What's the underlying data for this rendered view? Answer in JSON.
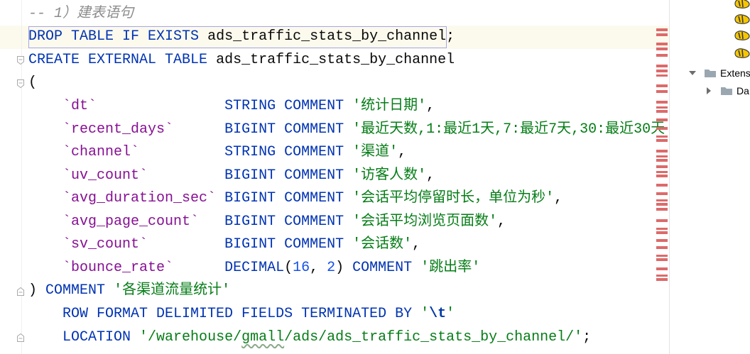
{
  "syntax_colors": {
    "keyword": "#0033b3",
    "identifier": "#080808",
    "quoted_identifier": "#871094",
    "string": "#067d17",
    "number": "#1750eb",
    "comment": "#8c8c8c",
    "escape": "#0037a6",
    "plain": "#080808"
  },
  "editor_colors": {
    "current_line": "#fcfaed",
    "statement_box": "#a7a7e8",
    "error_stripe_mark": "#dd6a6a",
    "typo_underline": "#8aa88a"
  },
  "editor": {
    "lines": [
      {
        "tokens": [
          {
            "comment": "-- 1）建表语句"
          }
        ]
      },
      {
        "current": true,
        "tokens": [
          {
            "keyword": "DROP TABLE IF EXISTS"
          },
          {
            "plain": " "
          },
          {
            "identifier": "ads_traffic_stats_by_channel"
          },
          {
            "plain": ";"
          }
        ]
      },
      {
        "fold_start": true,
        "tokens": [
          {
            "keyword": "CREATE EXTERNAL TABLE"
          },
          {
            "plain": " "
          },
          {
            "identifier": "ads_traffic_stats_by_channel"
          }
        ]
      },
      {
        "fold_start": true,
        "tokens": [
          {
            "plain": "("
          }
        ]
      },
      {
        "tokens": [
          {
            "plain": "    "
          },
          {
            "quoted_identifier": "`dt`"
          },
          {
            "plain": "               "
          },
          {
            "keyword": "STRING COMMENT"
          },
          {
            "plain": " "
          },
          {
            "string": "'统计日期'"
          },
          {
            "plain": ","
          }
        ]
      },
      {
        "tokens": [
          {
            "plain": "    "
          },
          {
            "quoted_identifier": "`recent_days`"
          },
          {
            "plain": "      "
          },
          {
            "keyword": "BIGINT COMMENT"
          },
          {
            "plain": " "
          },
          {
            "string": "'最近天数,1:最近1天,7:最近7天,30:最近30天"
          }
        ]
      },
      {
        "tokens": [
          {
            "plain": "    "
          },
          {
            "quoted_identifier": "`channel`"
          },
          {
            "plain": "          "
          },
          {
            "keyword": "STRING COMMENT"
          },
          {
            "plain": " "
          },
          {
            "string": "'渠道'"
          },
          {
            "plain": ","
          }
        ]
      },
      {
        "tokens": [
          {
            "plain": "    "
          },
          {
            "quoted_identifier": "`uv_count`"
          },
          {
            "plain": "         "
          },
          {
            "keyword": "BIGINT COMMENT"
          },
          {
            "plain": " "
          },
          {
            "string": "'访客人数'"
          },
          {
            "plain": ","
          }
        ]
      },
      {
        "tokens": [
          {
            "plain": "    "
          },
          {
            "quoted_identifier": "`avg_duration_sec`"
          },
          {
            "plain": " "
          },
          {
            "keyword": "BIGINT COMMENT"
          },
          {
            "plain": " "
          },
          {
            "string": "'会话平均停留时长，单位为秒'"
          },
          {
            "plain": ","
          }
        ]
      },
      {
        "tokens": [
          {
            "plain": "    "
          },
          {
            "quoted_identifier": "`avg_page_count`"
          },
          {
            "plain": "   "
          },
          {
            "keyword": "BIGINT COMMENT"
          },
          {
            "plain": " "
          },
          {
            "string": "'会话平均浏览页面数'"
          },
          {
            "plain": ","
          }
        ]
      },
      {
        "tokens": [
          {
            "plain": "    "
          },
          {
            "quoted_identifier": "`sv_count`"
          },
          {
            "plain": "         "
          },
          {
            "keyword": "BIGINT COMMENT"
          },
          {
            "plain": " "
          },
          {
            "string": "'会话数'"
          },
          {
            "plain": ","
          }
        ]
      },
      {
        "tokens": [
          {
            "plain": "    "
          },
          {
            "quoted_identifier": "`bounce_rate`"
          },
          {
            "plain": "      "
          },
          {
            "keyword": "DECIMAL"
          },
          {
            "plain": "("
          },
          {
            "number": "16"
          },
          {
            "plain": ", "
          },
          {
            "number": "2"
          },
          {
            "plain": ")"
          },
          {
            "plain": " "
          },
          {
            "keyword": "COMMENT"
          },
          {
            "plain": " "
          },
          {
            "string": "'跳出率'"
          }
        ]
      },
      {
        "fold_end": true,
        "tokens": [
          {
            "plain": ")"
          },
          {
            "plain": " "
          },
          {
            "keyword": "COMMENT"
          },
          {
            "plain": " "
          },
          {
            "string": "'各渠道流量统计'"
          }
        ]
      },
      {
        "tokens": [
          {
            "plain": "    "
          },
          {
            "keyword": "ROW FORMAT DELIMITED FIELDS TERMINATED BY"
          },
          {
            "plain": " "
          },
          {
            "string": "'"
          },
          {
            "escape": "\\t"
          },
          {
            "string": "'"
          }
        ]
      },
      {
        "fold_end": true,
        "tokens": [
          {
            "plain": "    "
          },
          {
            "keyword": "LOCATION"
          },
          {
            "plain": " "
          },
          {
            "string": "'/warehouse/"
          },
          {
            "string_typo": "gmall"
          },
          {
            "string": "/ads/ads_traffic_stats_by_channel/'"
          },
          {
            "plain": ";"
          }
        ]
      }
    ]
  },
  "database_tree": {
    "datasource_nodes": [
      {
        "icon": "hive-datasource-icon"
      },
      {
        "icon": "hive-datasource-icon"
      },
      {
        "icon": "hive-datasource-icon"
      },
      {
        "icon": "hive-datasource-icon"
      }
    ],
    "nodes": [
      {
        "label": "Extens",
        "expanded": true,
        "icon": "folder-icon"
      },
      {
        "label": "Da",
        "expanded": false,
        "icon": "folder-icon"
      }
    ]
  }
}
